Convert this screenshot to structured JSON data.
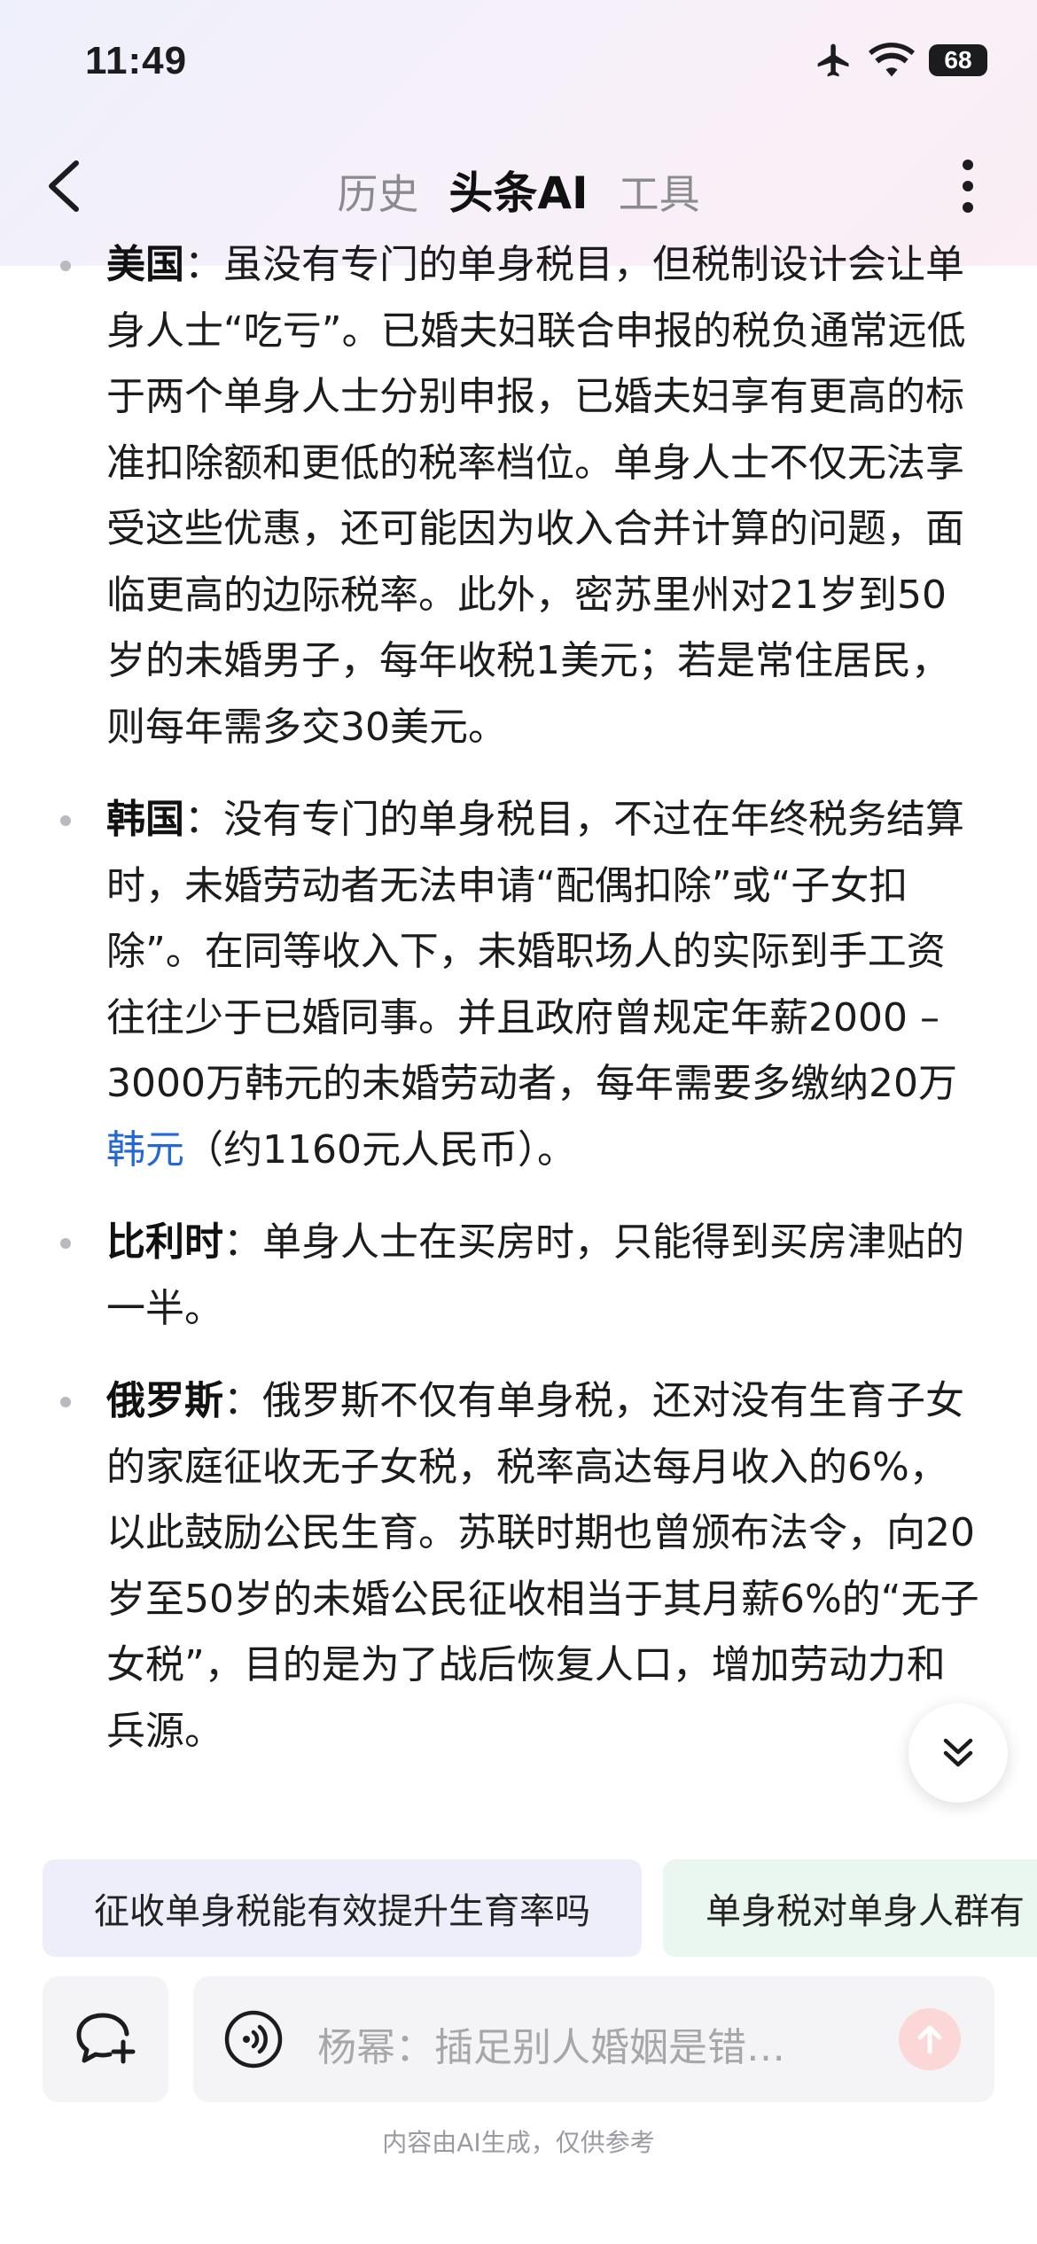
{
  "status": {
    "time": "11:49",
    "battery": "68"
  },
  "nav": {
    "tabs": [
      "历史",
      "头条AI",
      "工具"
    ],
    "active_tab": "头条AI"
  },
  "content": {
    "items": [
      {
        "term": "美国",
        "text": "：虽没有专门的单身税目，但税制设计会让单身人士“吃亏”。已婚夫妇联合申报的税负通常远低于两个单身人士分别申报，已婚夫妇享有更高的标准扣除额和更低的税率档位。单身人士不仅无法享受这些优惠，还可能因为收入合并计算的问题，面临更高的边际税率。此外，密苏里州对21岁到50岁的未婚男子，每年收税1美元；若是常住居民，则每年需多交30美元。"
      },
      {
        "term": "韩国",
        "text": "：没有专门的单身税目，不过在年终税务结算时，未婚劳动者无法申请“配偶扣除”或“子女扣除”。在同等收入下，未婚职场人的实际到手工资往往少于已婚同事。并且政府曾规定年薪2000 – 3000万韩元的未婚劳动者，每年需要多缴纳20万",
        "link": "韩元",
        "tail": "（约1160元人民币）。"
      },
      {
        "term": "比利时",
        "text": "：单身人士在买房时，只能得到买房津贴的一半。"
      },
      {
        "term": "俄罗斯",
        "text": "：俄罗斯不仅有单身税，还对没有生育子女的家庭征收无子女税，税率高达每月收入的6%，以此鼓励公民生育。苏联时期也曾颁布法令，向20岁至50岁的未婚公民征收相当于其月薪6%的“无子女税”，目的是为了战后恢复人口，增加劳动力和兵源。"
      }
    ]
  },
  "suggestions": [
    "征收单身税能有效提升生育率吗",
    "单身税对单身人群有"
  ],
  "input": {
    "placeholder": "杨幂：插足别人婚姻是错…"
  },
  "footer": {
    "note": "内容由AI生成，仅供参考"
  },
  "icons": {
    "back": "chevron-left-icon",
    "more": "more-vertical-icon",
    "airplane": "airplane-icon",
    "wifi": "wifi-icon",
    "scroll": "double-chevron-down-icon",
    "new_chat": "chat-plus-icon",
    "voice": "voice-icon",
    "send": "arrow-up-icon"
  },
  "colors": {
    "link": "#2468d8",
    "chip_1_bg": "#eeeefb",
    "chip_2_bg": "#eaf7f1",
    "send_bg": "#fbd7d7"
  }
}
